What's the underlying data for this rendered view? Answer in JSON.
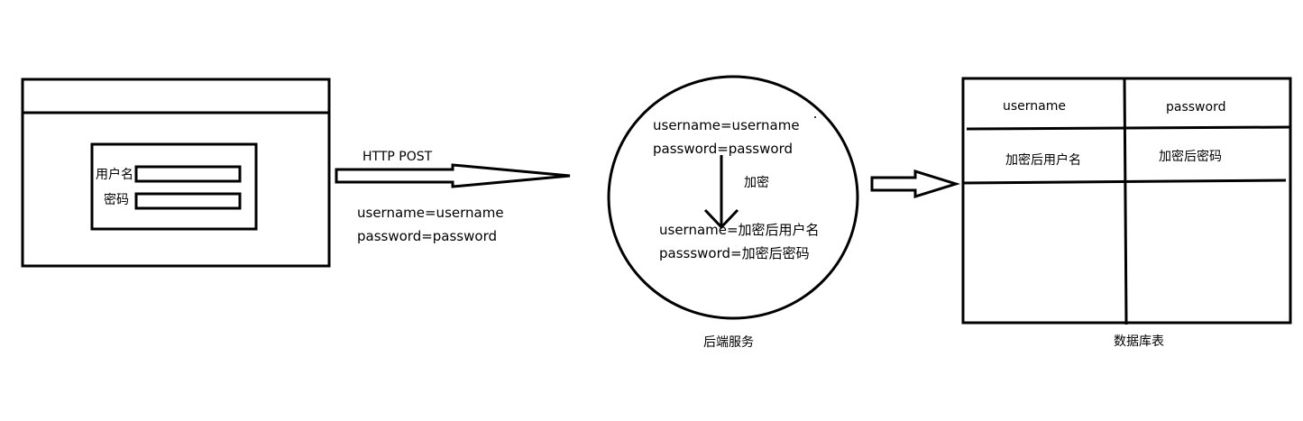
{
  "login_form": {
    "username_label": "用户名",
    "password_label": "密码"
  },
  "request": {
    "method_label": "HTTP POST",
    "username_line": "username=username",
    "password_line": "password=password"
  },
  "backend": {
    "input_username": "username=username",
    "input_password": "password=password",
    "encrypt_label": "加密",
    "output_username": "username=加密后用户名",
    "output_password": "passsword=加密后密码",
    "caption": "后端服务"
  },
  "database_table": {
    "columns": [
      "username",
      "password"
    ],
    "rows": [
      [
        "加密后用户名",
        "加密后密码"
      ]
    ],
    "caption": "数据库表"
  }
}
